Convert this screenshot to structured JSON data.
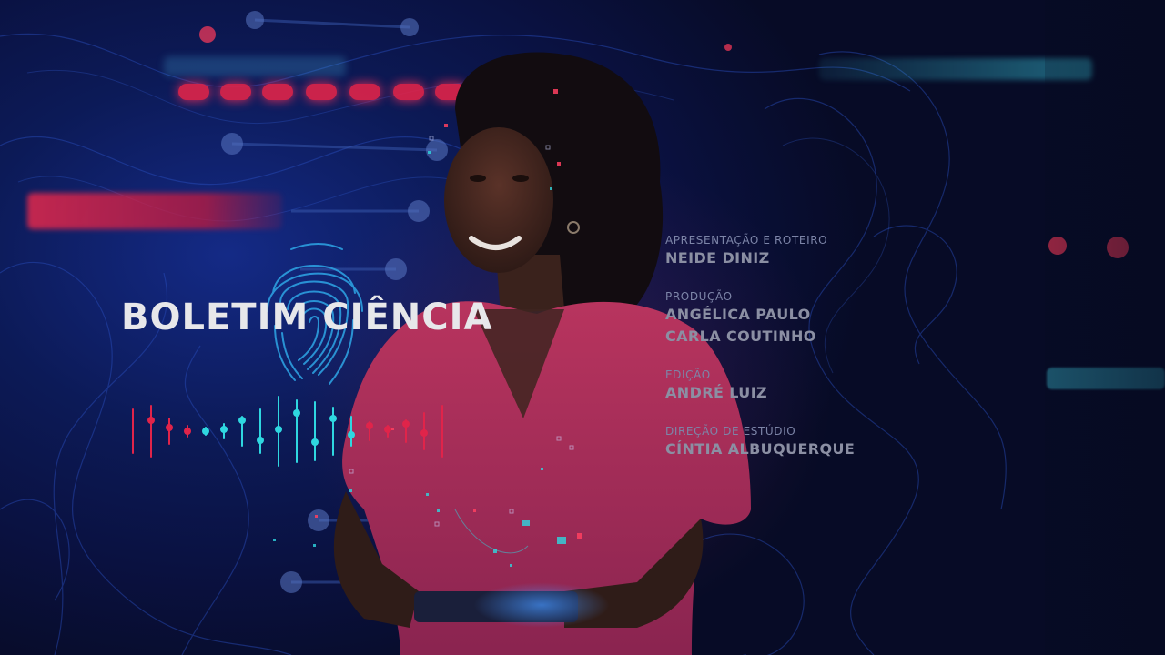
{
  "show_title": "BOLETIM CIÊNCIA",
  "credits": [
    {
      "role": "APRESENTAÇÃO E ROTEIRO",
      "names": [
        "NEIDE DINIZ"
      ]
    },
    {
      "role": "PRODUÇÃO",
      "names": [
        "ANGÉLICA PAULO",
        "CARLA COUTINHO"
      ]
    },
    {
      "role": "EDIÇÃO",
      "names": [
        "ANDRÉ LUIZ"
      ]
    },
    {
      "role": "DIREÇÃO DE ESTÚDIO",
      "names": [
        "CÍNTIA ALBUQUERQUE"
      ]
    }
  ],
  "colors": {
    "background": "#0c1a57",
    "accent_cyan": "#2fd7e0",
    "accent_red": "#e0244a",
    "title_text": "#e7e7ea",
    "credit_text": "#8b8fa3",
    "presenter_top": "#b8345e"
  },
  "icons": [
    "fingerprint-icon",
    "audio-equalizer-icon"
  ]
}
